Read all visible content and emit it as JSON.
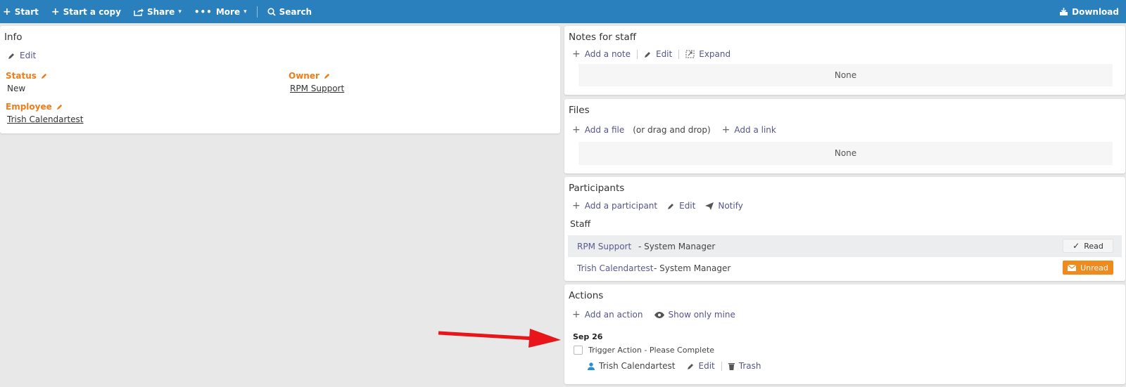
{
  "toolbar": {
    "start": "Start",
    "start_copy": "Start a copy",
    "share": "Share",
    "more": "More",
    "search": "Search",
    "download": "Download"
  },
  "info": {
    "title": "Info",
    "edit": "Edit",
    "status_label": "Status",
    "status_value": "New",
    "owner_label": "Owner",
    "owner_value": "RPM Support",
    "employee_label": "Employee",
    "employee_value": "Trish Calendartest"
  },
  "notes": {
    "title": "Notes for staff",
    "add": "Add a note",
    "edit": "Edit",
    "expand": "Expand",
    "empty": "None"
  },
  "files": {
    "title": "Files",
    "add_file": "Add a file",
    "drag_hint": "(or drag and drop)",
    "add_link": "Add a link",
    "empty": "None"
  },
  "participants": {
    "title": "Participants",
    "add": "Add a participant",
    "edit": "Edit",
    "notify": "Notify",
    "group": "Staff",
    "rows": [
      {
        "name": "RPM Support",
        "role": "- System Manager",
        "status": "Read"
      },
      {
        "name": "Trish Calendartest",
        "role": "- System Manager",
        "status": "Unread"
      }
    ]
  },
  "actions": {
    "title": "Actions",
    "add": "Add an action",
    "show_mine": "Show only mine",
    "date": "Sep 26",
    "item_title": "Trigger Action - Please Complete",
    "assignee": "Trish Calendartest",
    "edit": "Edit",
    "trash": "Trash"
  },
  "colors": {
    "toolbar": "#2a7fbd",
    "accent_orange": "#ee7d1a",
    "link": "#5a5a8c",
    "arrow": "#e8161b"
  }
}
